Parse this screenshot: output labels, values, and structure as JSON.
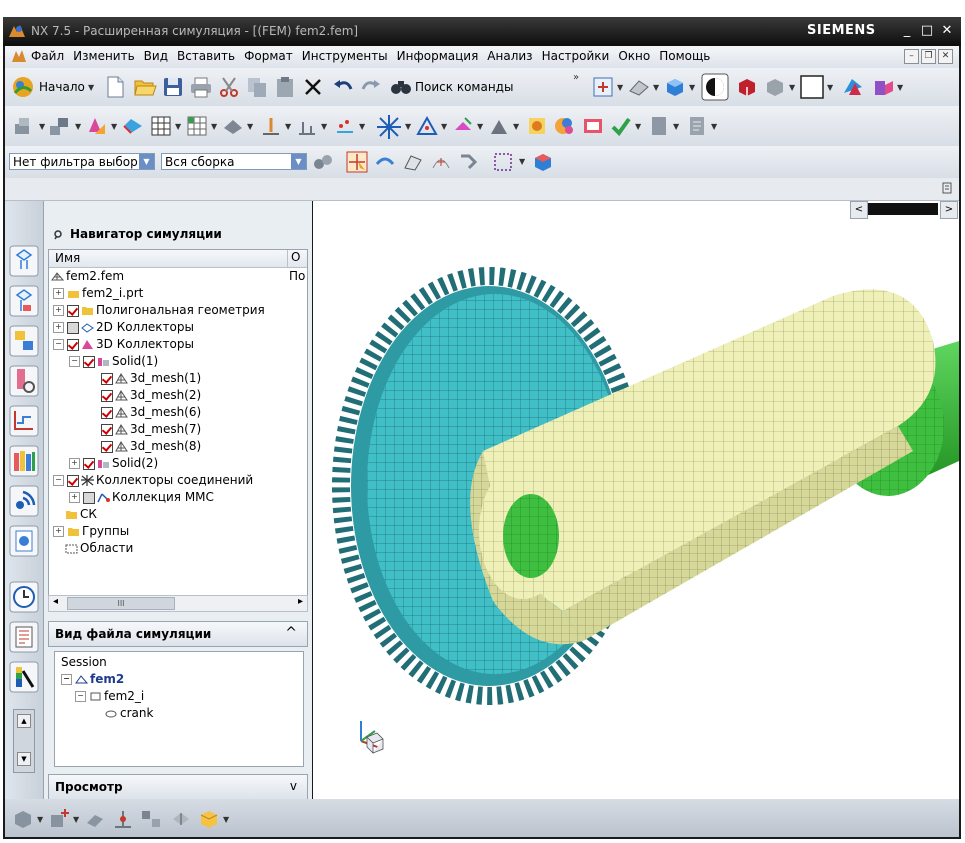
{
  "window": {
    "title": "NX 7.5 - Расширенная симуляция - [(FEM) fem2.fem]",
    "brand": "SIEMENS",
    "controls": [
      "_",
      "□",
      "✕"
    ]
  },
  "menu": {
    "items": [
      "Файл",
      "Изменить",
      "Вид",
      "Вставить",
      "Формат",
      "Инструменты",
      "Информация",
      "Анализ",
      "Настройки",
      "Окно",
      "Помощь"
    ]
  },
  "toolbar": {
    "start_label": "Начало",
    "search_label": "Поиск команды",
    "filter_value": "Нет фильтра выбор",
    "assembly_value": "Вся сборка"
  },
  "navigator": {
    "title": "Навигатор симуляции",
    "col_name": "Имя",
    "col_other": "О",
    "root": "fem2.fem",
    "root_other": "По",
    "items": [
      "fem2_i.prt",
      "Полигональная геометрия",
      "2D Коллекторы",
      "3D Коллекторы",
      "Solid(1)",
      "3d_mesh(1)",
      "3d_mesh(2)",
      "3d_mesh(6)",
      "3d_mesh(7)",
      "3d_mesh(8)",
      "Solid(2)",
      "Коллекторы соединений",
      "Коллекция MMC",
      "СК",
      "Группы",
      "Области"
    ],
    "scroll_mark": "III"
  },
  "sim_file_view": {
    "title": "Вид файла симуляции",
    "collapse": "^",
    "items": [
      "Session",
      "fem2",
      "fem2_i",
      "crank"
    ]
  },
  "preview": {
    "title": "Просмотр",
    "expand": "v"
  },
  "colors": {
    "gear_cyan": "#3fbfc8",
    "crank_yellow": "#eef0b8",
    "shaft_green": "#3fbf3f",
    "title_bg": "#0d0d0d"
  }
}
